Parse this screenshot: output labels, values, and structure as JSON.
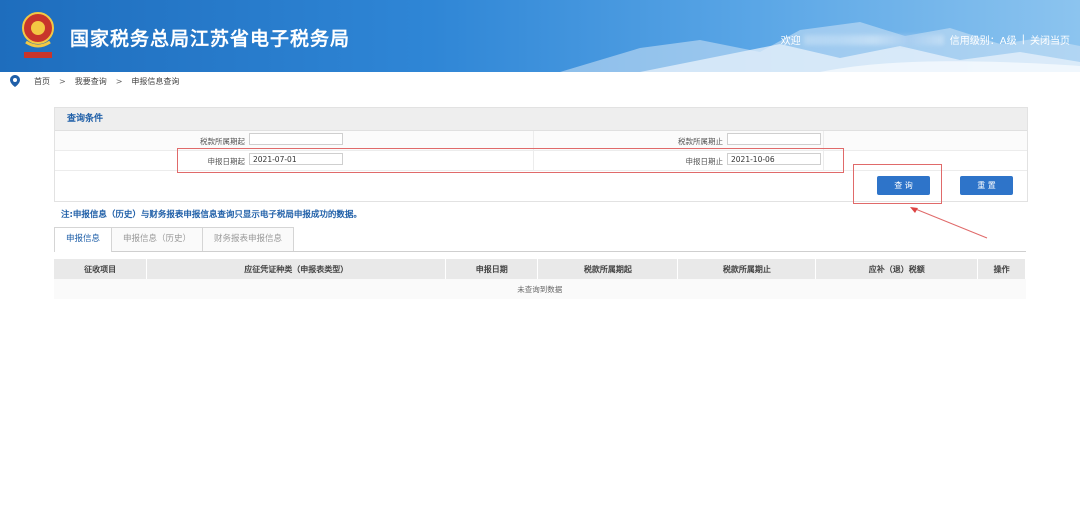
{
  "header": {
    "site_title": "国家税务总局江苏省电子税务局",
    "welcome_prefix": "欢迎",
    "credit_level": "信用级别：A级",
    "separator": "|",
    "close_page": "关闭当页",
    "emblem_caption": "中国税务"
  },
  "breadcrumb": {
    "items": [
      "首页",
      "我要查询",
      "申报信息查询"
    ],
    "arrow": ">"
  },
  "query": {
    "section_title": "查询条件",
    "tax_period_start_label": "税款所属期起",
    "tax_period_start_value": "",
    "tax_period_end_label": "税款所属期止",
    "tax_period_end_value": "",
    "filing_date_start_label": "申报日期起",
    "filing_date_start_value": "2021-07-01",
    "filing_date_end_label": "申报日期止",
    "filing_date_end_value": "2021-10-06",
    "query_button": "查 询",
    "reset_button": "重 置"
  },
  "note": "注:申报信息（历史）与财务报表申报信息查询只显示电子税局申报成功的数据。",
  "tabs": [
    "申报信息",
    "申报信息（历史）",
    "财务报表申报信息"
  ],
  "table": {
    "columns": [
      "征收项目",
      "应征凭证种类（申报表类型）",
      "申报日期",
      "税款所属期起",
      "税款所属期止",
      "应补（退）税额",
      "操作"
    ],
    "empty_text": "未查询到数据"
  },
  "colors": {
    "header_blue": "#2f86d6",
    "button_blue": "#2e74c9",
    "title_text_blue": "#1f5fa8",
    "annotation_red": "#e06a6a"
  }
}
